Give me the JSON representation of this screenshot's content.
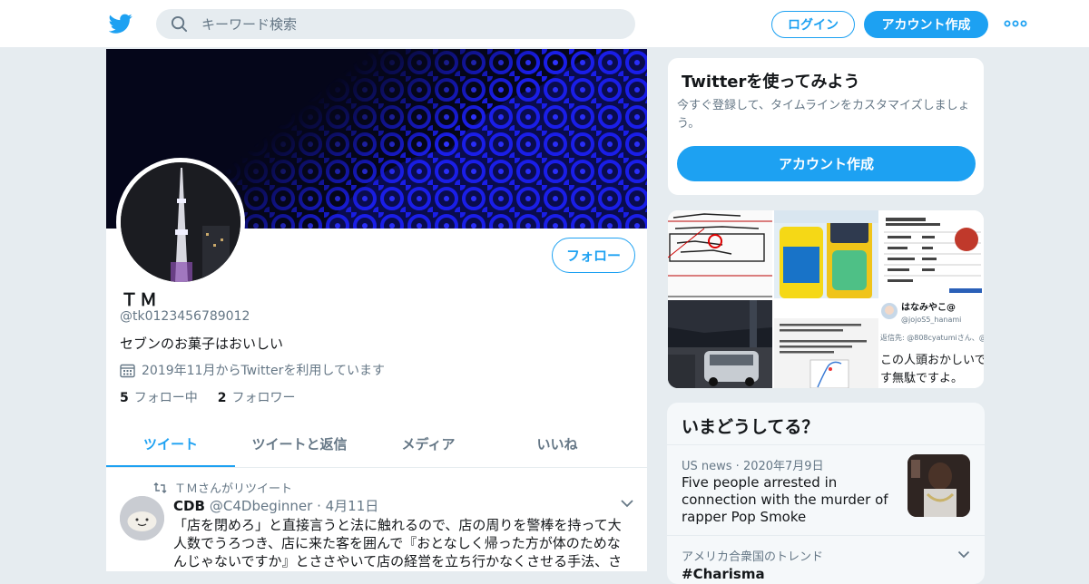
{
  "header": {
    "search_placeholder": "キーワード検索",
    "login_label": "ログイン",
    "signup_label": "アカウント作成"
  },
  "profile": {
    "follow_label": "フォロー",
    "name": "ＴＭ",
    "handle": "@tk0123456789012",
    "bio": "セブンのお菓子はおいしい",
    "joined": "2019年11月からTwitterを利用しています",
    "following_count": "5",
    "following_label": "フォロー中",
    "followers_count": "2",
    "followers_label": "フォロワー"
  },
  "tabs": [
    {
      "label": "ツイート"
    },
    {
      "label": "ツイートと返信"
    },
    {
      "label": "メディア"
    },
    {
      "label": "いいね"
    }
  ],
  "tweet": {
    "retweet_label": "ＴＭさんがリツイート",
    "author_name": "CDB",
    "author_handle": "@C4Dbeginner",
    "date": "4月11日",
    "text": "「店を閉めろ」と直接言うと法に触れるので、店の周りを警棒を持って大人数でうろつき、店に来た客を囲んで『おとなしく帰った方が体のためなんじゃないですか』とささやいて店の経営を立ち行かなくさせる手法、さすが警察は賢察だ、と一瞬の手品をみた。まともに見ている"
  },
  "signup_card": {
    "title": "Twitterを使ってみよう",
    "subtitle": "今すぐ登録して、タイムラインをカスタマイズしましょう。",
    "button_label": "アカウント作成"
  },
  "media_grid": {
    "thumb6_user": "はなみやこ@",
    "thumb6_handle": "@jojoS5_hanami",
    "thumb6_line1": "返信先: @808cyatumiさん、@",
    "thumb6_line2": "この人頭おかしいで",
    "thumb6_line3": "す無駄ですよ。"
  },
  "trends": {
    "title": "いまどうしてる？",
    "news_source": "US news",
    "news_date": "2020年7月9日",
    "news_headline": "Five people arrested in connection with the murder of rapper Pop Smoke",
    "trend_context": "アメリカ合衆国のトレンド",
    "trend_tag": "#Charisma"
  },
  "colors": {
    "accent": "#1da1f2",
    "secondary_text": "#657786",
    "banner_bg": "#05061a",
    "banner_pattern": "#1a1ee8"
  }
}
